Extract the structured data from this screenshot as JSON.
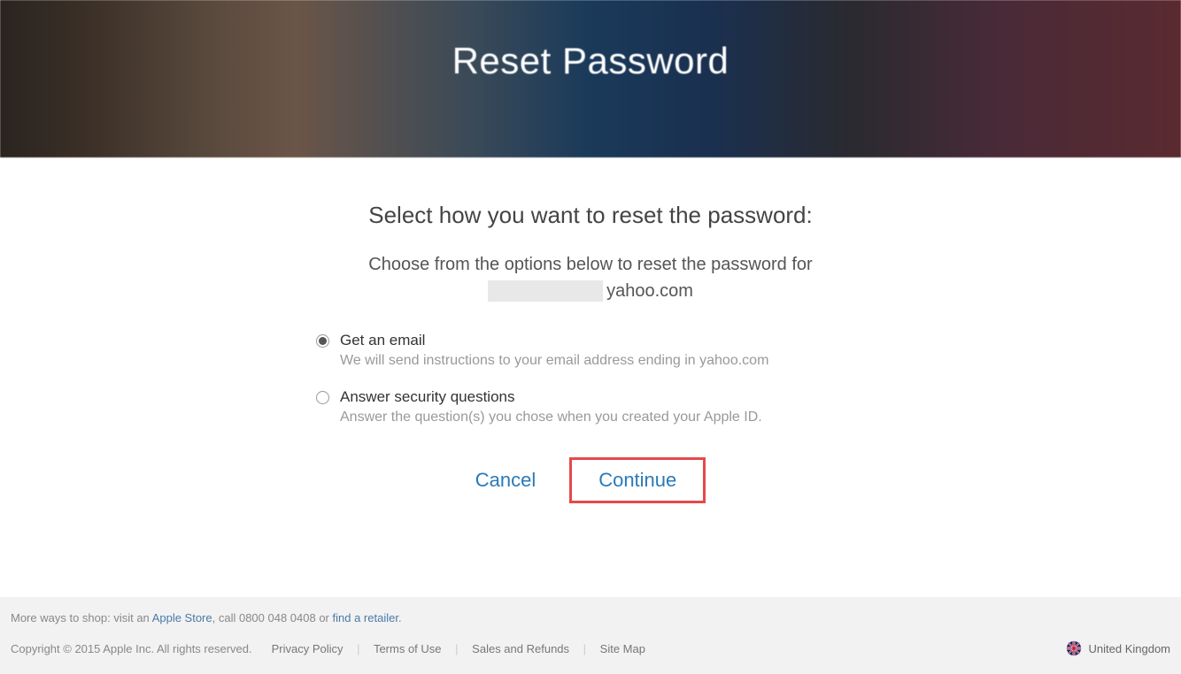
{
  "hero": {
    "title": "Reset Password"
  },
  "main": {
    "instruction": "Select how you want to reset the password:",
    "subinstruction": "Choose from the options below to reset the password for",
    "email_domain": "yahoo.com"
  },
  "options": [
    {
      "label": "Get an email",
      "description": "We will send instructions to your email address ending in yahoo.com",
      "selected": true
    },
    {
      "label": "Answer security questions",
      "description": "Answer the question(s) you chose when you created your Apple ID.",
      "selected": false
    }
  ],
  "actions": {
    "cancel": "Cancel",
    "continue": "Continue"
  },
  "footer": {
    "shop_prefix": "More ways to shop: visit an ",
    "store_link": "Apple Store",
    "shop_mid": ", call 0800 048 0408 or ",
    "retailer_link": "find a retailer",
    "shop_suffix": ".",
    "copyright": "Copyright © 2015 Apple Inc. All rights reserved.",
    "nav": [
      "Privacy Policy",
      "Terms of Use",
      "Sales and Refunds",
      "Site Map"
    ],
    "locale": "United Kingdom"
  }
}
